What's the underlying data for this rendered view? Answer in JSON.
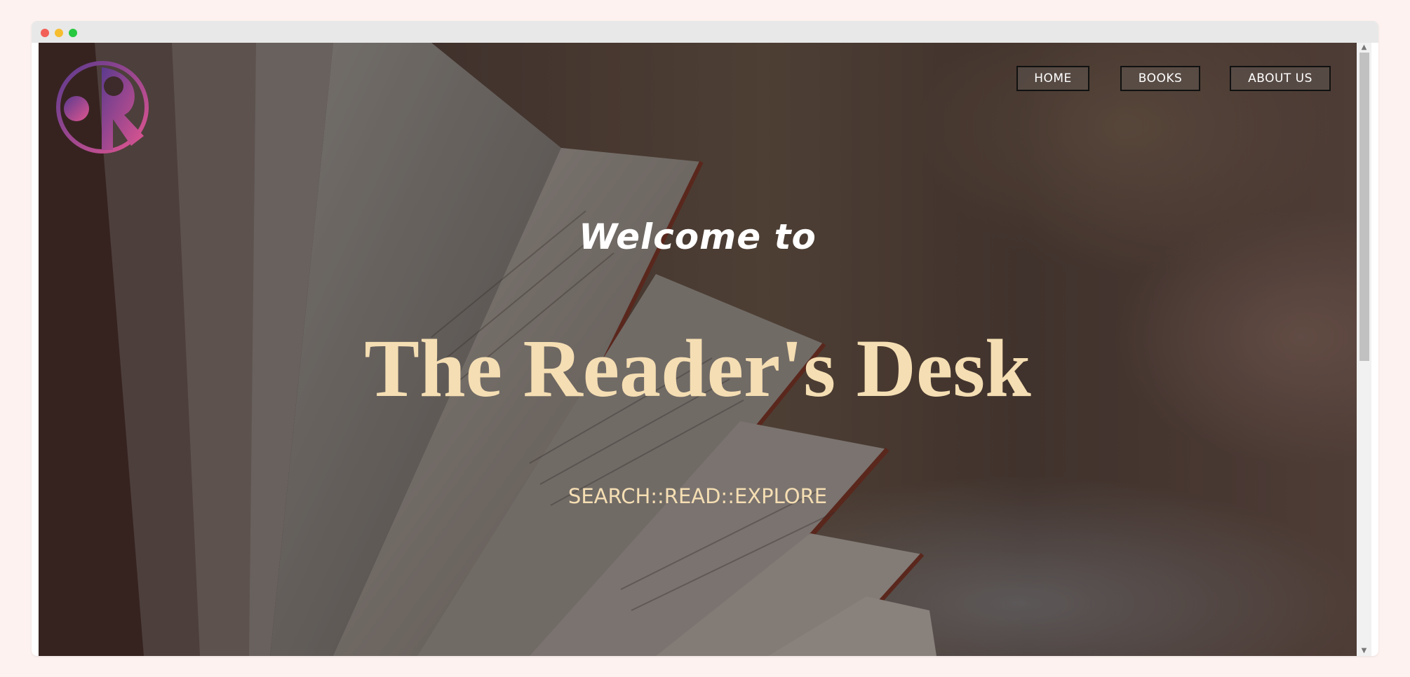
{
  "window": {
    "controls": [
      "close",
      "minimize",
      "maximize"
    ]
  },
  "logo": {
    "icon": "readers-desk-logo-icon",
    "letter": "R",
    "gradient": [
      "#5b3a8e",
      "#e05590"
    ]
  },
  "nav": {
    "items": [
      {
        "label": "HOME"
      },
      {
        "label": "BOOKS"
      },
      {
        "label": "ABOUT US"
      }
    ]
  },
  "hero": {
    "welcome": "Welcome to",
    "title": "The Reader's Desk",
    "tagline": "SEARCH::READ::EXPLORE",
    "background_icon": "open-book-image"
  },
  "colors": {
    "title": "#f5deb3",
    "welcome": "#ffffff",
    "nav_border": "#111111"
  },
  "scrollbar": {
    "up_glyph": "▲",
    "down_glyph": "▼"
  }
}
